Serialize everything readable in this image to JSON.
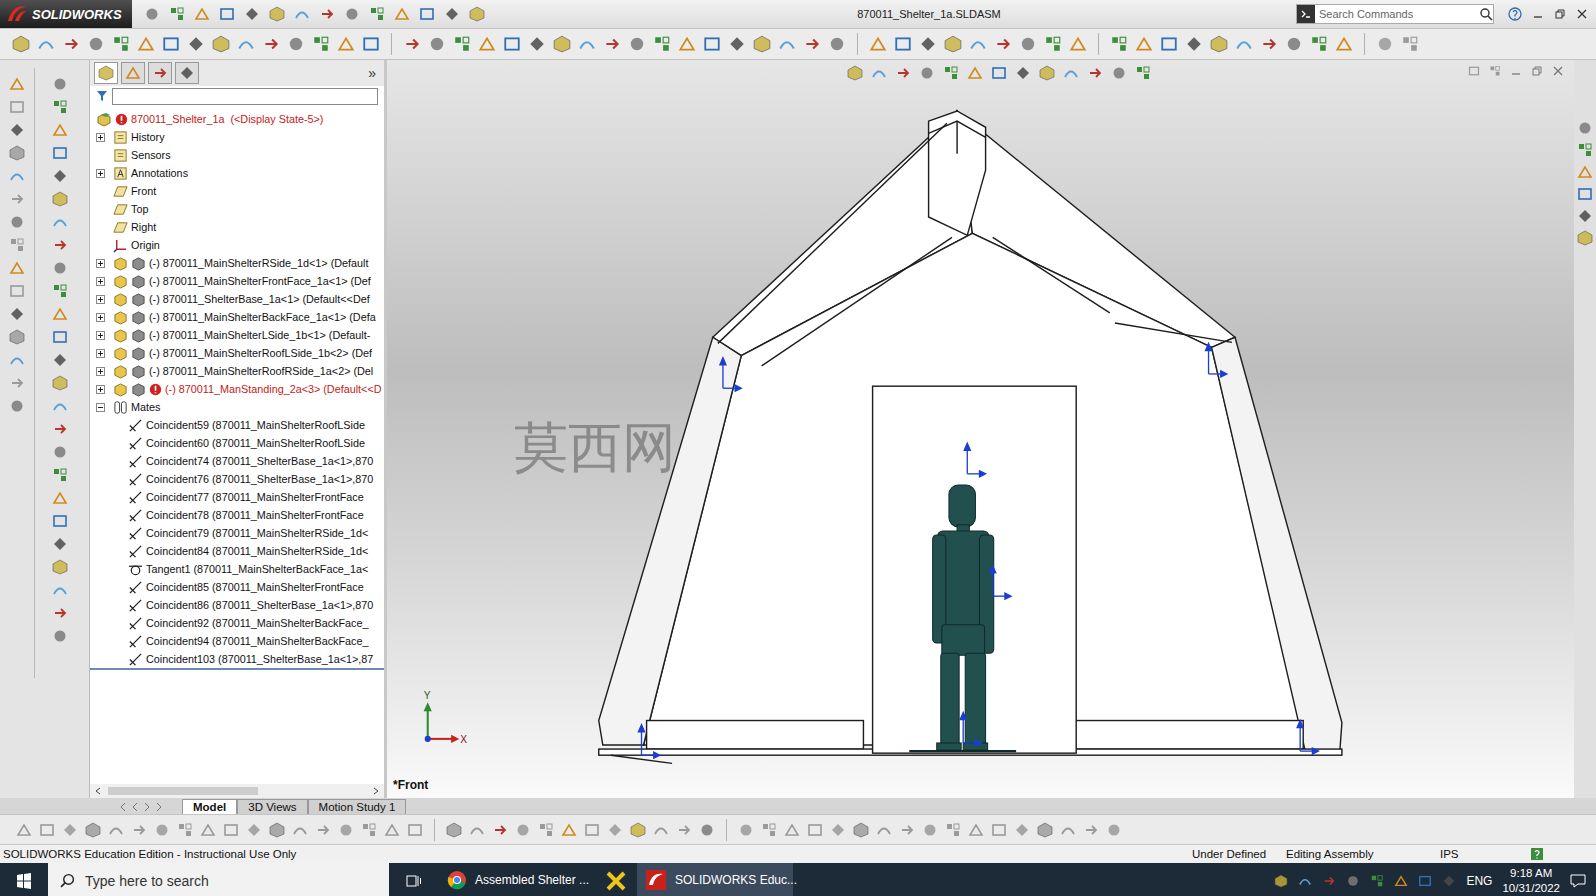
{
  "window": {
    "app": "SOLIDWORKS",
    "title": "870011_Shelter_1a.SLDASM"
  },
  "search": {
    "placeholder": "Search Commands"
  },
  "feature_tree": {
    "collapse": "»",
    "items": [
      {
        "label": "870011_Shelter_1a  (<Display State-5>)",
        "kind": "root",
        "error": true
      },
      {
        "label": "History",
        "kind": "folder",
        "expanded": false,
        "error": false
      },
      {
        "label": "Sensors",
        "kind": "folder",
        "error": false
      },
      {
        "label": "Annotations",
        "kind": "annotations",
        "expanded": false,
        "error": false
      },
      {
        "label": "Front",
        "kind": "plane",
        "error": false
      },
      {
        "label": "Top",
        "kind": "plane",
        "error": false
      },
      {
        "label": "Right",
        "kind": "plane",
        "error": false
      },
      {
        "label": "Origin",
        "kind": "origin",
        "error": false
      },
      {
        "label": "(-) 870011_MainShelterRSide_1d<1> (Default",
        "kind": "part",
        "expanded": false,
        "error": false
      },
      {
        "label": "(-) 870011_MainShelterFrontFace_1a<1> (Def",
        "kind": "part",
        "expanded": false,
        "error": false
      },
      {
        "label": "(-) 870011_ShelterBase_1a<1> (Default<<Def",
        "kind": "part",
        "expanded": false,
        "error": false
      },
      {
        "label": "(-) 870011_MainShelterBackFace_1a<1> (Defa",
        "kind": "part",
        "expanded": false,
        "error": false
      },
      {
        "label": "(-) 870011_MainShelterLSide_1b<1> (Default-",
        "kind": "part",
        "expanded": false,
        "error": false
      },
      {
        "label": "(-) 870011_MainShelterRoofLSide_1b<2> (Def",
        "kind": "part",
        "expanded": false,
        "error": false
      },
      {
        "label": "(-) 870011_MainShelterRoofRSide_1a<2> (Del",
        "kind": "part",
        "expanded": false,
        "error": false
      },
      {
        "label": "(-) 870011_ManStanding_2a<3> (Default<<D",
        "kind": "part",
        "expanded": false,
        "error": true
      },
      {
        "label": "Mates",
        "kind": "mates",
        "expanded": true,
        "error": false
      },
      {
        "label": "Coincident59 (870011_MainShelterRoofLSide",
        "kind": "mate",
        "error": false
      },
      {
        "label": "Coincident60 (870011_MainShelterRoofLSide",
        "kind": "mate",
        "error": false
      },
      {
        "label": "Coincident74 (870011_ShelterBase_1a<1>,870",
        "kind": "mate",
        "error": false
      },
      {
        "label": "Coincident76 (870011_ShelterBase_1a<1>,870",
        "kind": "mate",
        "error": false
      },
      {
        "label": "Coincident77 (870011_MainShelterFrontFace",
        "kind": "mate",
        "error": false
      },
      {
        "label": "Coincident78 (870011_MainShelterFrontFace",
        "kind": "mate",
        "error": false
      },
      {
        "label": "Coincident79 (870011_MainShelterRSide_1d<",
        "kind": "mate",
        "error": false
      },
      {
        "label": "Coincident84 (870011_MainShelterRSide_1d<",
        "kind": "mate",
        "error": false
      },
      {
        "label": "Tangent1 (870011_MainShelterBackFace_1a<",
        "kind": "tangent",
        "error": false
      },
      {
        "label": "Coincident85 (870011_MainShelterFrontFace",
        "kind": "mate",
        "error": false
      },
      {
        "label": "Coincident86 (870011_ShelterBase_1a<1>,870",
        "kind": "mate",
        "error": false
      },
      {
        "label": "Coincident92 (870011_MainShelterBackFace_",
        "kind": "mate",
        "error": false
      },
      {
        "label": "Coincident94 (870011_MainShelterBackFace_",
        "kind": "mate",
        "error": false
      },
      {
        "label": "Coincident103 (870011_ShelterBase_1a<1>,87",
        "kind": "mate",
        "error": false
      }
    ]
  },
  "graphics": {
    "view": "*Front",
    "watermark": "莫西网",
    "axes": {
      "x": "X",
      "y": "Y"
    }
  },
  "bottom_tabs": [
    {
      "label": "Model",
      "selected": true
    },
    {
      "label": "3D Views",
      "selected": false
    },
    {
      "label": "Motion Study 1",
      "selected": false
    }
  ],
  "status_bar": {
    "edition": "SOLIDWORKS Education Edition - Instructional Use Only",
    "state": "Under Defined",
    "mode": "Editing Assembly",
    "units": "IPS"
  },
  "taskbar": {
    "search": "Type here to search",
    "apps": [
      {
        "kind": "chrome",
        "label": "Assembled Shelter ...",
        "active": false
      },
      {
        "kind": "pinned",
        "active": false
      },
      {
        "kind": "solidworks",
        "label": "SOLIDWORKS Educ...",
        "active": true
      }
    ],
    "language": "ENG",
    "time": "9:18 AM",
    "date": "10/31/2022"
  }
}
